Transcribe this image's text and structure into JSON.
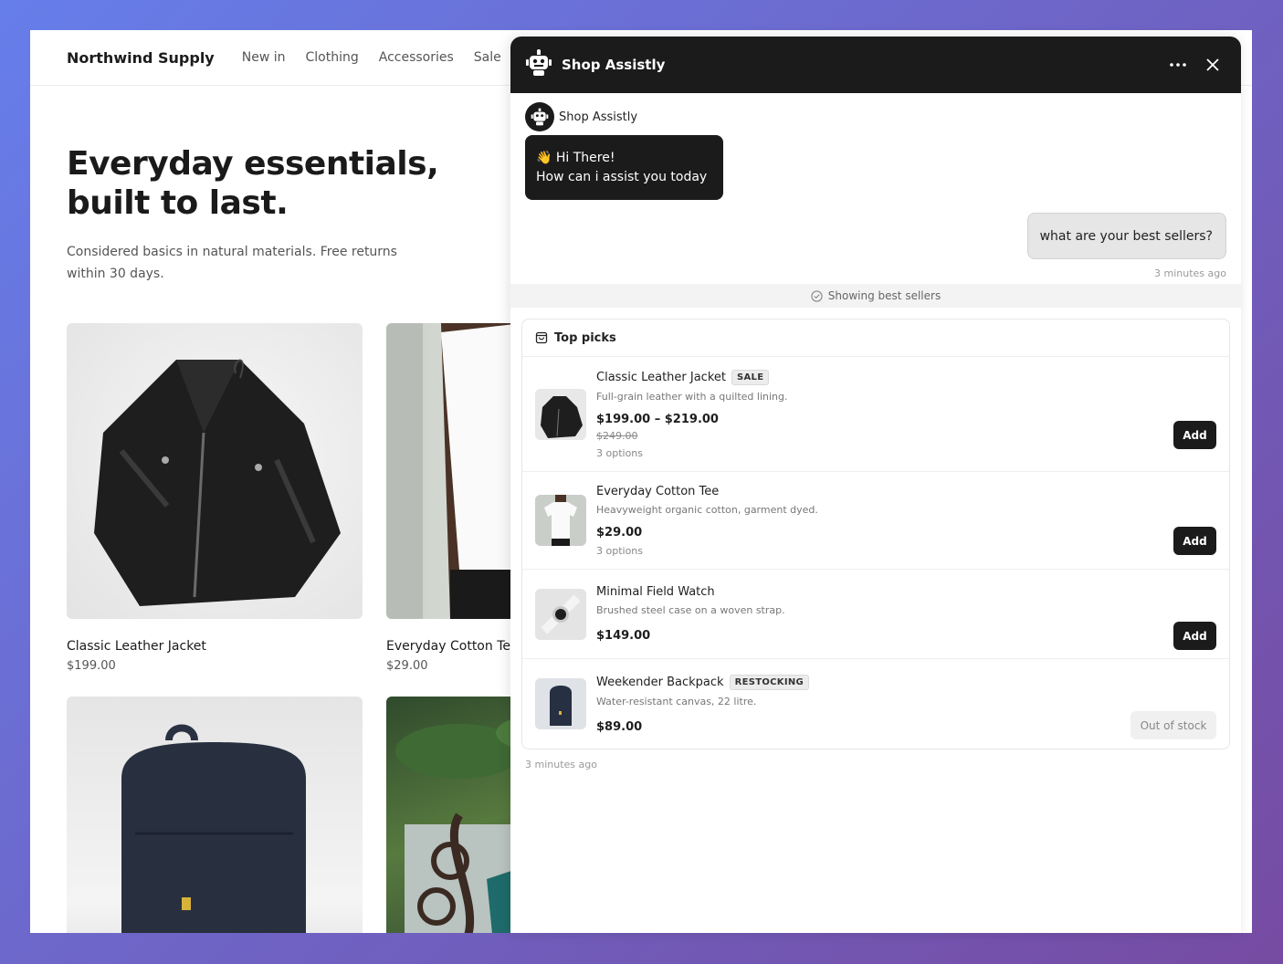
{
  "store": {
    "brand": "Northwind Supply",
    "nav": [
      "New in",
      "Clothing",
      "Accessories",
      "Sale"
    ],
    "hero_title": "Everyday essentials, built to last.",
    "hero_subtitle": "Considered basics in natural materials. Free returns within 30 days.",
    "products": [
      {
        "name": "Classic Leather Jacket",
        "price": "$199.00"
      },
      {
        "name": "Everyday Cotton Tee",
        "price": "$29.00"
      },
      {
        "name": "",
        "price": ""
      },
      {
        "name": "",
        "price": ""
      }
    ]
  },
  "chat": {
    "title": "Shop Assistly",
    "bot_name": "Shop Assistly",
    "greeting_line1": "👋 Hi There!",
    "greeting_line2": "How can i assist you today",
    "user_message": "what are your best sellers?",
    "user_timestamp": "3 minutes ago",
    "status": "Showing best sellers",
    "picks_title": "Top picks",
    "picks_timestamp": "3 minutes ago",
    "items": [
      {
        "name": "Classic Leather Jacket",
        "badge": "SALE",
        "desc": "Full-grain leather with a quilted lining.",
        "price": "$199.00 – $219.00",
        "old_price": "$249.00",
        "options": "3 options",
        "action": "Add"
      },
      {
        "name": "Everyday Cotton Tee",
        "badge": "",
        "desc": "Heavyweight organic cotton, garment dyed.",
        "price": "$29.00",
        "old_price": "",
        "options": "3 options",
        "action": "Add"
      },
      {
        "name": "Minimal Field Watch",
        "badge": "",
        "desc": "Brushed steel case on a woven strap.",
        "price": "$149.00",
        "old_price": "",
        "options": "",
        "action": "Add"
      },
      {
        "name": "Weekender Backpack",
        "badge": "RESTOCKING",
        "desc": "Water-resistant canvas, 22 litre.",
        "price": "$89.00",
        "old_price": "",
        "options": "",
        "action": "Out of stock"
      }
    ]
  },
  "icons": {
    "bot": "robot-icon",
    "more": "more-horizontal-icon",
    "close": "close-icon",
    "status": "check-circle-icon",
    "picks": "shopping-bag-icon"
  },
  "colors": {
    "dark": "#1b1b1b",
    "background_gradient_start": "#667eea",
    "background_gradient_end": "#764ba2"
  }
}
